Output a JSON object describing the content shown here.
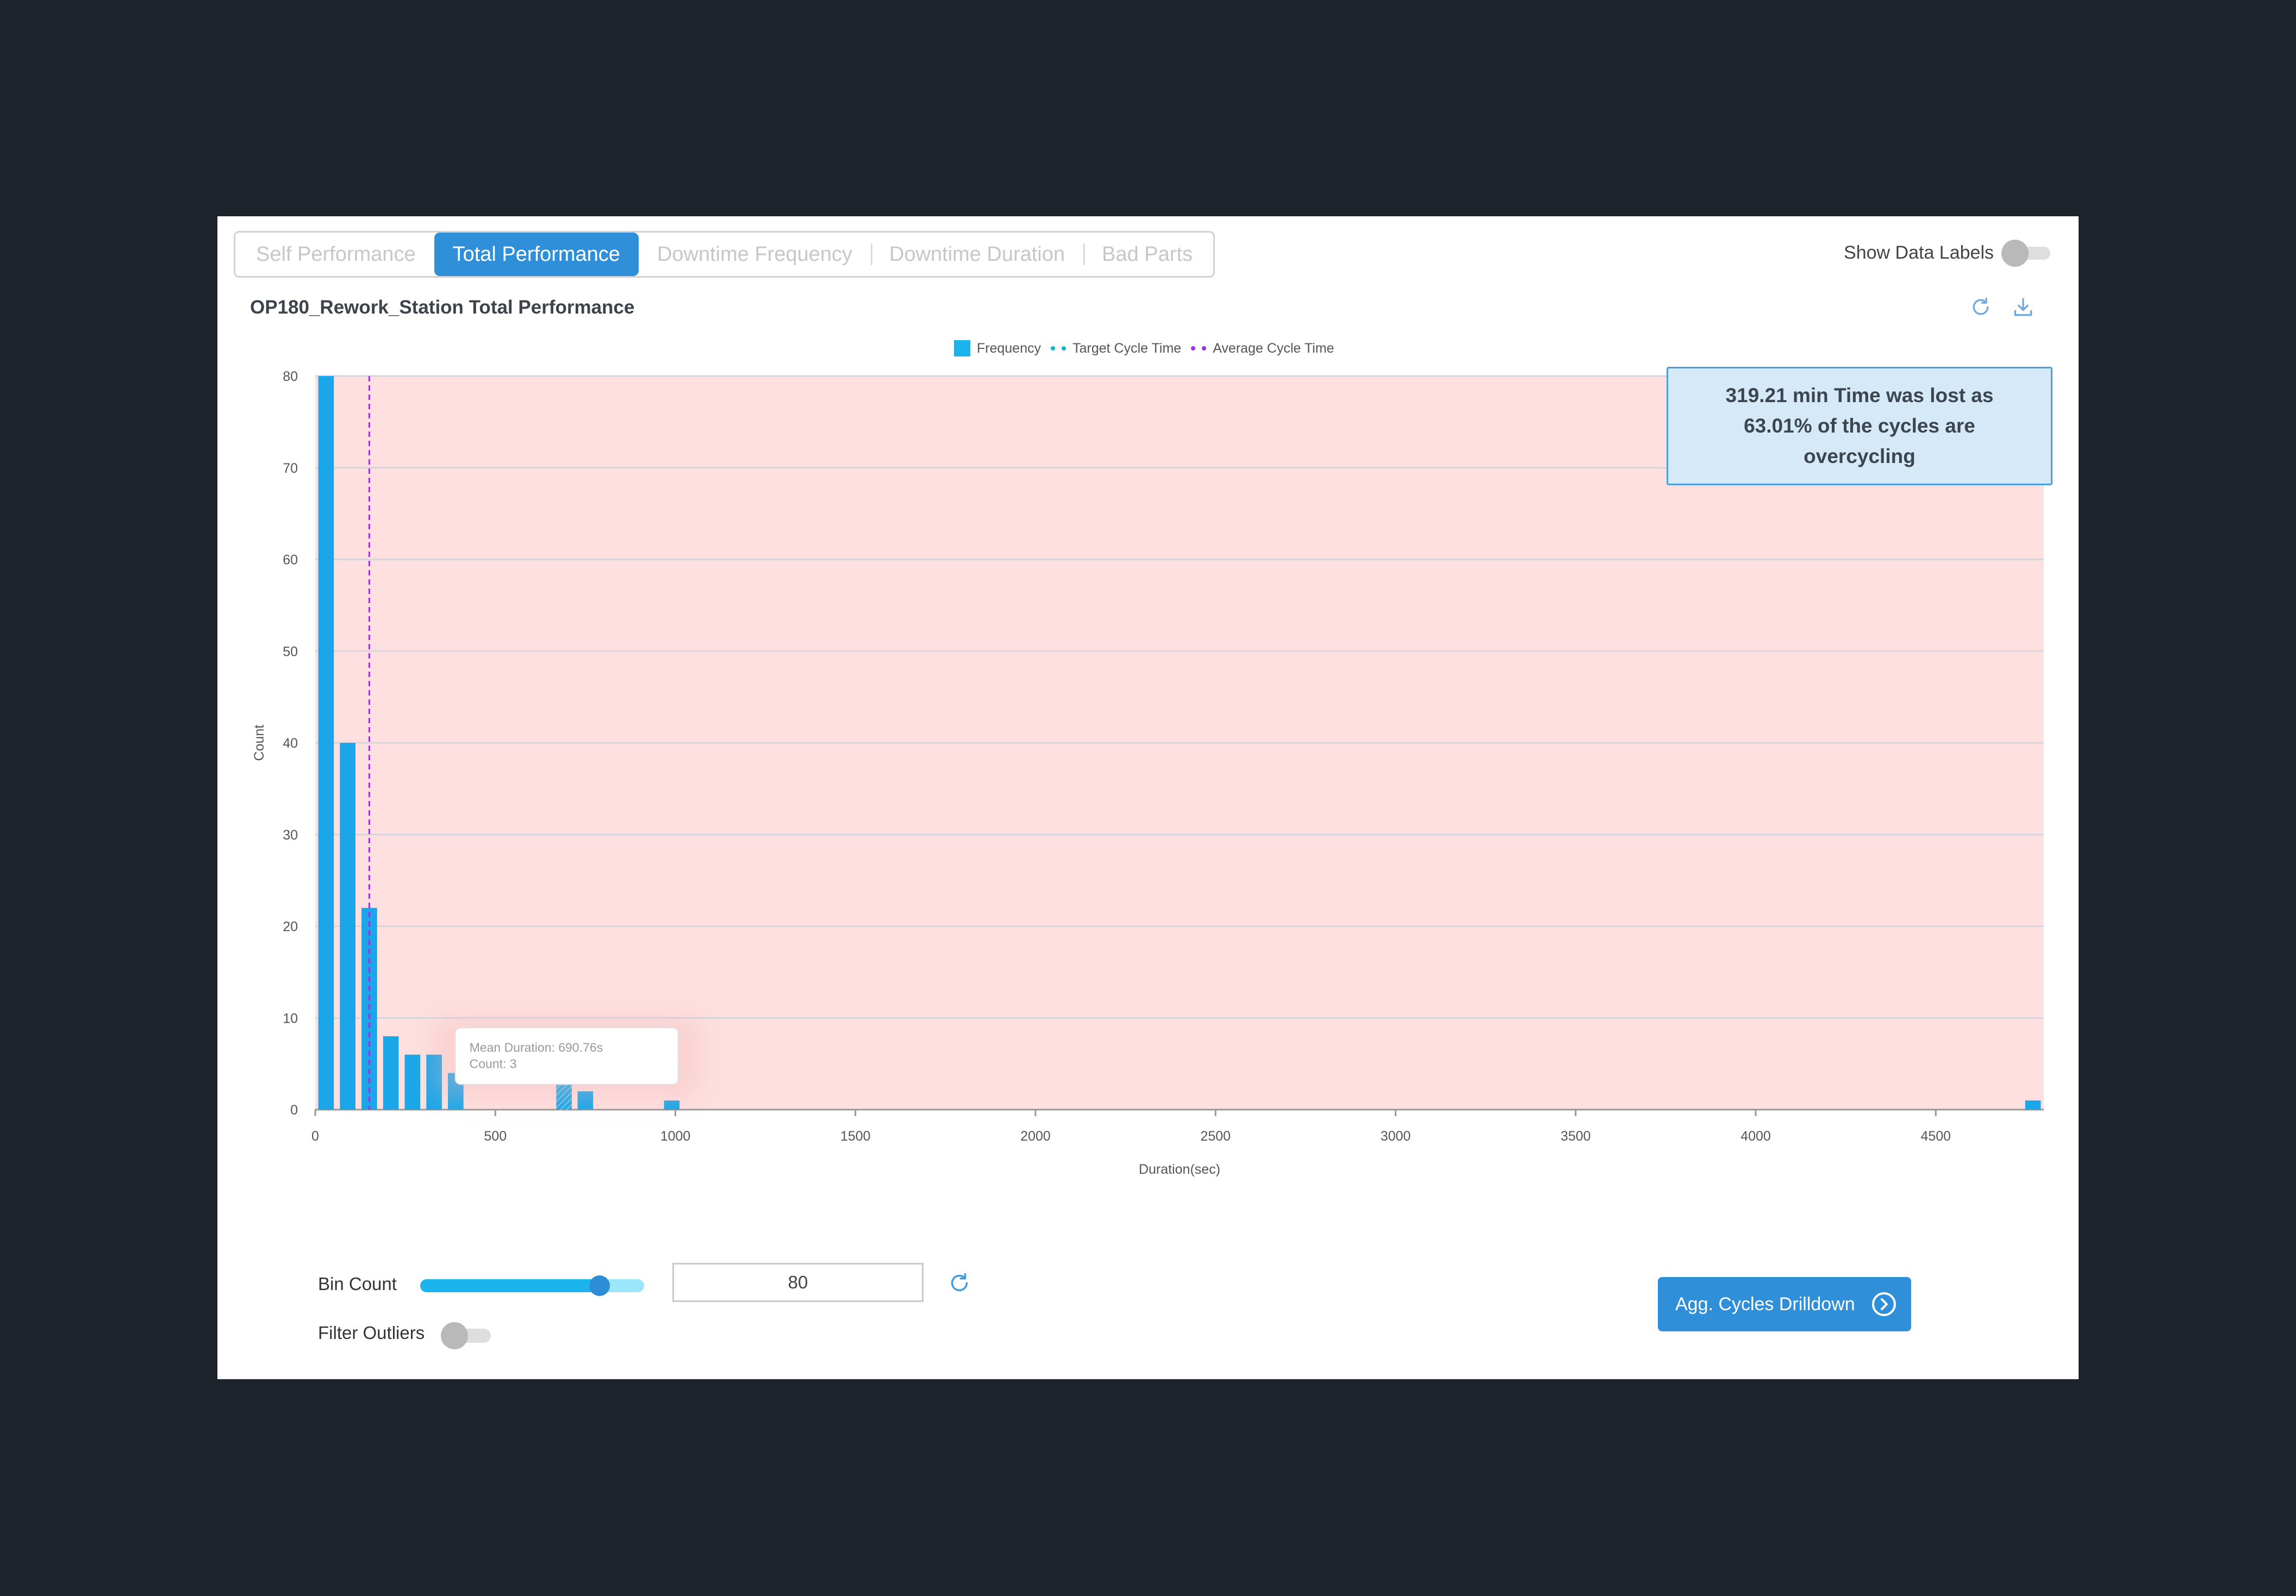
{
  "tabs": [
    {
      "label": "Self Performance",
      "active": false
    },
    {
      "label": "Total Performance",
      "active": true
    },
    {
      "label": "Downtime Frequency",
      "active": false
    },
    {
      "label": "Downtime Duration",
      "active": false
    },
    {
      "label": "Bad Parts",
      "active": false
    }
  ],
  "show_data_labels": {
    "label": "Show Data Labels",
    "on": false
  },
  "chart_title": "OP180_Rework_Station Total Performance",
  "toolbar": {
    "refresh_icon": "refresh-icon",
    "download_icon": "download-icon"
  },
  "legend": [
    {
      "label": "Frequency",
      "color": "#1ab3f0",
      "marker": "square"
    },
    {
      "label": "Target Cycle Time",
      "color": "#12b6c8",
      "marker": "dash"
    },
    {
      "label": "Average Cycle Time",
      "color": "#9b30e8",
      "marker": "dash"
    }
  ],
  "callout": "319.21 min Time was lost as 63.01% of the cycles are overcycling",
  "tooltip": {
    "line1": "Mean Duration: 690.76s",
    "line2": "Count: 3"
  },
  "chart_data": {
    "type": "bar",
    "xlabel": "Duration(sec)",
    "ylabel": "Count",
    "xlim": [
      0,
      4800
    ],
    "ylim": [
      0,
      80
    ],
    "xticks": [
      0,
      500,
      1000,
      1500,
      2000,
      2500,
      3000,
      3500,
      4000,
      4500
    ],
    "yticks": [
      0,
      10,
      20,
      30,
      40,
      50,
      60,
      70,
      80
    ],
    "bin_width": 60,
    "bars": [
      {
        "x": 30,
        "count": 80
      },
      {
        "x": 90,
        "count": 40
      },
      {
        "x": 150,
        "count": 22
      },
      {
        "x": 210,
        "count": 8
      },
      {
        "x": 270,
        "count": 6
      },
      {
        "x": 330,
        "count": 6
      },
      {
        "x": 390,
        "count": 4
      },
      {
        "x": 690.76,
        "count": 3,
        "hovered": true
      },
      {
        "x": 750,
        "count": 2
      },
      {
        "x": 990,
        "count": 1
      },
      {
        "x": 4770,
        "count": 1
      }
    ],
    "average_cycle_time": 150,
    "overcycling_region_color": "#fde0df",
    "grid": true,
    "legend_position": "top"
  },
  "bin_count": {
    "label": "Bin Count",
    "value": "80",
    "slider_fraction": 0.8
  },
  "filter_outliers": {
    "label": "Filter Outliers",
    "on": false
  },
  "drilldown_button": {
    "label": "Agg. Cycles Drilldown"
  }
}
